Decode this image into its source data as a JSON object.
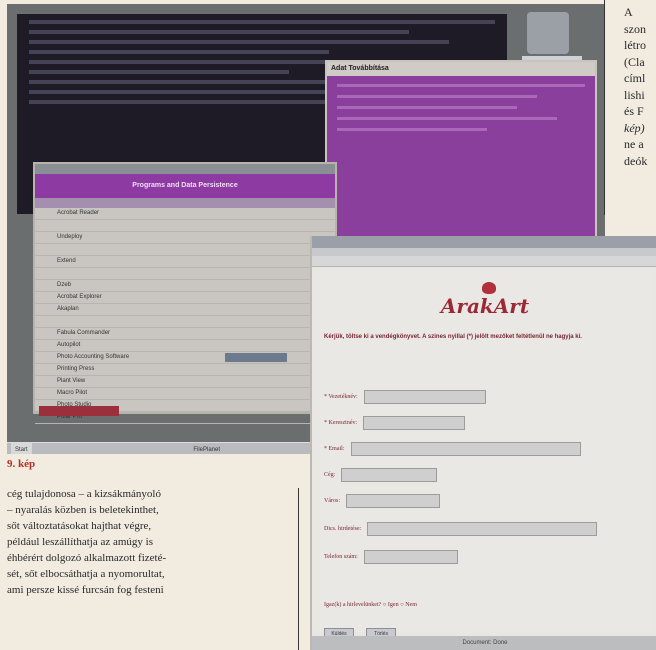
{
  "photo": {
    "desktop_icon_label": "",
    "purple_window_title": "Adat Továbbítása",
    "table_window": {
      "title": "",
      "header": "Programs and Data Persistence",
      "rows": [
        "Acrobat Reader",
        "",
        "Undeploy",
        "",
        "Extend",
        "",
        "Dzeb",
        "Acrobat Explorer",
        "Akaplan",
        "",
        "Fabula Commander",
        "Autopilot",
        "Photo Accounting Software",
        "Printing Press",
        "Plant View",
        "Macro Pilot",
        "Photo Studio",
        "Polar Pro"
      ],
      "highlighted_row": 12
    },
    "taskbar": {
      "start": "Start",
      "task": "FilePlanet"
    },
    "browser": {
      "logo": "ArakArt",
      "intro": "Kérjük, töltse ki a vendégkönyvet. A szines nyillal (*) jelölt mezőket feltétlenül ne hagyja ki.",
      "fields": [
        {
          "label": "* Vezetéknév:",
          "width": 120
        },
        {
          "label": "* Keresztnév:",
          "width": 100
        },
        {
          "label": "* Email:",
          "width": 228
        },
        {
          "label": "Cég:",
          "width": 94
        },
        {
          "label": "Város:",
          "width": 92
        },
        {
          "label": "Dics. hirdetése:",
          "width": 228
        },
        {
          "label": "Telefon szám:",
          "width": 92
        }
      ],
      "radio": "Igaz(k) a hirlevelünket?  ○ Igen  ○ Nem",
      "buttons": [
        "Küldés",
        "Törlés"
      ],
      "status": "Document: Done"
    }
  },
  "caption": "9. kép",
  "body_lines": [
    "cég tulajdonosa – a kizsákmányoló",
    "– nyaralás közben is beletekinthet,",
    "sőt változtatásokat hajthat végre,",
    "például leszállíthatja az amúgy is",
    "éhbérért dolgozó alkalmazott fizeté-",
    "sét, sőt elbocsáthatja a nyomorultat,",
    "ami persze kissé furcsán fog festeni"
  ],
  "side_lines": [
    {
      "text": "A",
      "italic": false
    },
    {
      "text": "szon",
      "italic": false
    },
    {
      "text": "létro",
      "italic": false
    },
    {
      "text": "(Cla",
      "italic": false
    },
    {
      "text": "címl",
      "italic": false
    },
    {
      "text": "lishi",
      "italic": false
    },
    {
      "text": "és F",
      "italic": false
    },
    {
      "text": "kép)",
      "italic": true
    },
    {
      "text": "ne a",
      "italic": false
    },
    {
      "text": "deók",
      "italic": false
    }
  ]
}
